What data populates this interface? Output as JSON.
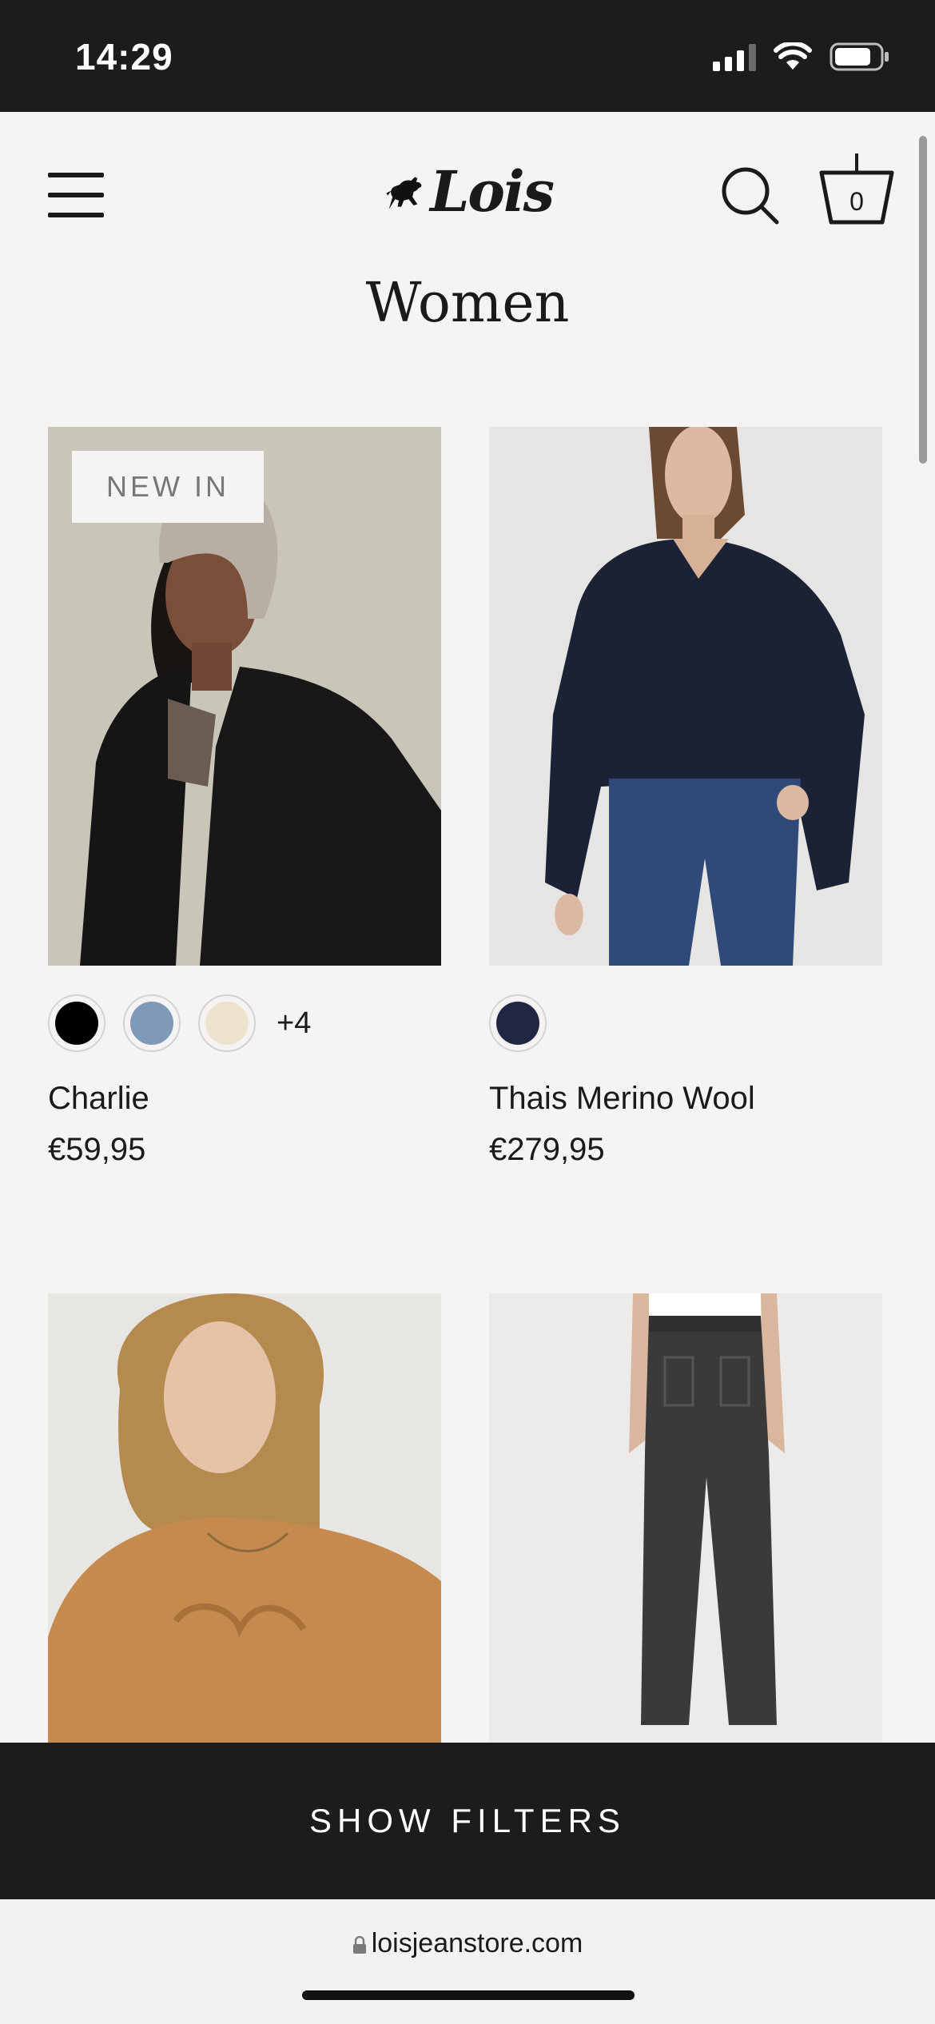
{
  "status": {
    "time": "14:29",
    "icons": [
      "cellular-signal-icon",
      "wifi-icon",
      "battery-icon"
    ]
  },
  "header": {
    "logo_text": "Lois",
    "icons": [
      "hamburger-menu-icon",
      "bull-logo-icon",
      "search-icon",
      "basket-icon"
    ],
    "basket_count": "0"
  },
  "page": {
    "title": "Women"
  },
  "products": [
    {
      "badge": "NEW IN",
      "name": "Charlie",
      "price": "€59,95",
      "swatches": [
        "#000000",
        "#7f9ab8",
        "#ece2cd"
      ],
      "more_colors": "+4"
    },
    {
      "name": "Thais Merino Wool",
      "price": "€279,95",
      "swatches": [
        "#1f2744"
      ]
    },
    {
      "name": "",
      "price": ""
    },
    {
      "name": "",
      "price": ""
    }
  ],
  "filters": {
    "label": "SHOW FILTERS"
  },
  "browser": {
    "url": "loisjeanstore.com"
  },
  "colors": {
    "background": "#f5f4f2",
    "bar_dark": "#1c1c1c"
  }
}
